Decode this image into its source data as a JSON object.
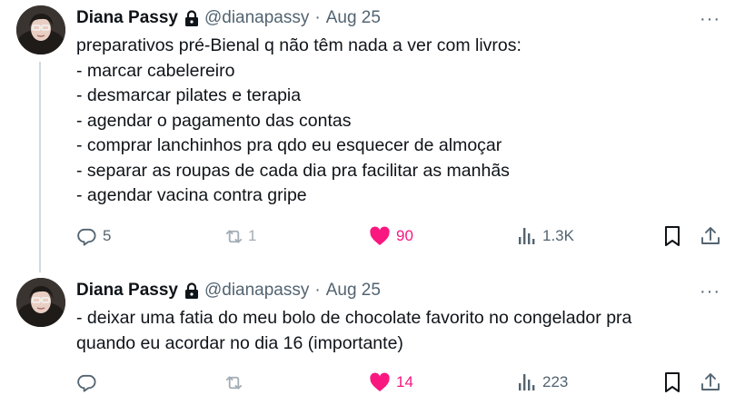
{
  "tweets": [
    {
      "author": {
        "name": "Diana Passy",
        "handle": "@dianapassy"
      },
      "date": "Aug 25",
      "lines": [
        "preparativos pré-Bienal q não têm nada a ver com livros:",
        "- marcar cabelereiro",
        "- desmarcar pilates e terapia",
        "- agendar o pagamento das contas",
        "- comprar lanchinhos pra qdo eu esquecer de almoçar",
        "- separar as roupas de cada dia pra facilitar as manhãs",
        "- agendar vacina contra gripe"
      ],
      "stats": {
        "replies": "5",
        "reposts": "1",
        "likes": "90",
        "views": "1.3K"
      }
    },
    {
      "author": {
        "name": "Diana Passy",
        "handle": "@dianapassy"
      },
      "date": "Aug 25",
      "lines": [
        "- deixar uma fatia do meu bolo de chocolate favorito no congelador pra",
        "quando eu acordar no dia 16 (importante)"
      ],
      "stats": {
        "replies": "",
        "reposts": "",
        "likes": "14",
        "views": "223"
      }
    }
  ],
  "ui": {
    "separator": "·",
    "more": "···"
  },
  "icons": {
    "lock": "lock-icon",
    "reply": "reply-icon",
    "repost": "repost-icon",
    "like": "heart-icon",
    "views": "views-icon",
    "bookmark": "bookmark-icon",
    "share": "share-icon",
    "more": "more-icon"
  },
  "colors": {
    "text": "#0f1419",
    "secondary": "#536471",
    "like": "#f91880",
    "thread": "#cfd9de"
  }
}
